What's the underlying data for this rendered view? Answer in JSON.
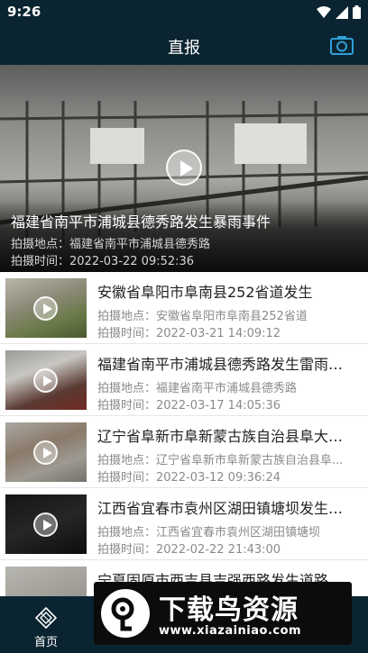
{
  "status_bar": {
    "time": "9:26"
  },
  "header": {
    "title": "直报",
    "camera_icon": "camera-icon"
  },
  "featured": {
    "title": "福建省南平市浦城县德秀路发生暴雨事件",
    "location": "拍摄地点：福建省南平市浦城县德秀路",
    "time": "拍摄时间：2022-03-22 09:52:36"
  },
  "reports": [
    {
      "title": "安徽省阜阳市阜南县252省道发生",
      "location": "拍摄地点：安徽省阜阳市阜南县252省道",
      "time": "拍摄时间：2022-03-21 14:09:12"
    },
    {
      "title": "福建省南平市浦城县德秀路发生雷雨大...",
      "location": "拍摄地点：福建省南平市浦城县德秀路",
      "time": "拍摄时间：2022-03-17 14:05:36"
    },
    {
      "title": "辽宁省阜新市阜新蒙古族自治县阜大线...",
      "location": "拍摄地点：辽宁省阜新市阜新蒙古族自治县阜...",
      "time": "拍摄时间：2022-03-12 09:36:24"
    },
    {
      "title": "江西省宜春市袁州区湖田镇塘坝发生暴...",
      "location": "拍摄地点：江西省宜春市袁州区湖田镇塘坝",
      "time": "拍摄时间：2022-02-22 21:43:00"
    },
    {
      "title": "宁夏固原市西吉县吉强西路发生道路结...",
      "location": "",
      "time": ""
    }
  ],
  "tab_bar": {
    "home_label": "首页"
  },
  "watermark": {
    "text": "下载鸟资源",
    "url": "www.xiazainiao.com"
  },
  "colors": {
    "bar_background": "#0b2431",
    "camera_accent": "#2f9fd6"
  }
}
